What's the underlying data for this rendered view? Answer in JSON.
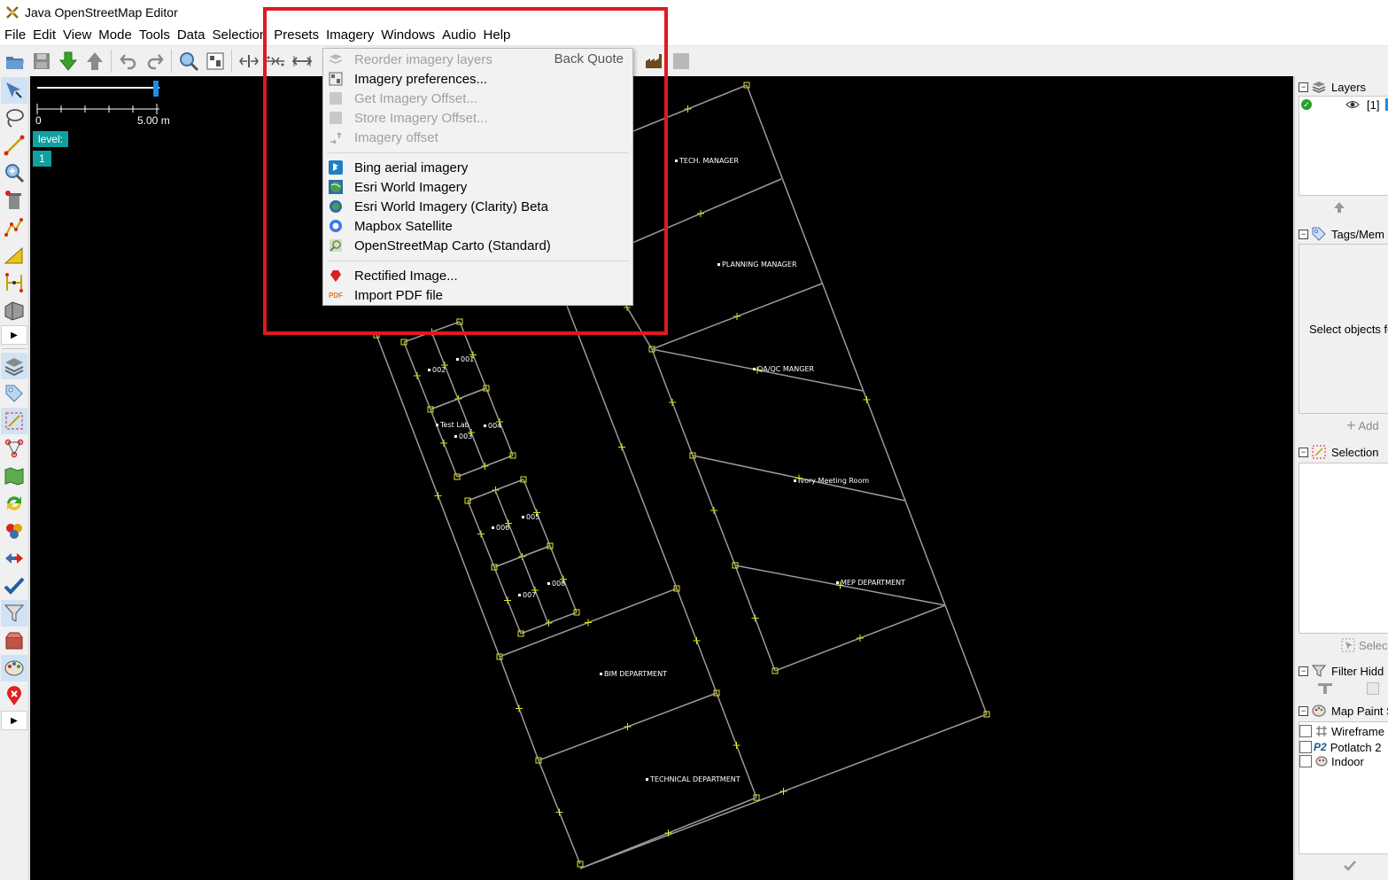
{
  "window": {
    "title": "Java OpenStreetMap Editor"
  },
  "menubar": [
    "File",
    "Edit",
    "View",
    "Mode",
    "Tools",
    "Data",
    "Selection",
    "Presets",
    "Imagery",
    "Windows",
    "Audio",
    "Help"
  ],
  "imagery_menu": {
    "items": [
      {
        "label": "Reorder imagery layers",
        "accel": "Back Quote",
        "enabled": false,
        "icon": "reorder-layers-icon"
      },
      {
        "label": "Imagery preferences...",
        "enabled": true,
        "icon": "imagery-preferences-icon"
      },
      {
        "label": "Get Imagery Offset...",
        "enabled": false,
        "icon": "get-offset-icon"
      },
      {
        "label": "Store Imagery Offset...",
        "enabled": false,
        "icon": "store-offset-icon"
      },
      {
        "label": "Imagery offset",
        "enabled": false,
        "icon": "imagery-offset-icon"
      },
      {
        "label": "Bing aerial imagery",
        "enabled": true,
        "icon": "bing-icon"
      },
      {
        "label": "Esri World Imagery",
        "enabled": true,
        "icon": "esri-icon"
      },
      {
        "label": "Esri World Imagery (Clarity) Beta",
        "enabled": true,
        "icon": "esri-clarity-icon"
      },
      {
        "label": "Mapbox Satellite",
        "enabled": true,
        "icon": "mapbox-icon"
      },
      {
        "label": "OpenStreetMap Carto (Standard)",
        "enabled": true,
        "icon": "osm-carto-icon"
      },
      {
        "label": "Rectified Image...",
        "enabled": true,
        "icon": "rectified-image-icon"
      },
      {
        "label": "Import PDF file",
        "enabled": true,
        "icon": "pdf-icon"
      }
    ],
    "pdf_icon_text": "PDF"
  },
  "map": {
    "scale_label_start": "0",
    "scale_label_end": "5.00 m",
    "level_label": "level:",
    "level_value": "1",
    "room_labels": [
      "TECH. MANAGER",
      "PLANNING MANAGER",
      "QA/QC MANGER",
      "Ivory Meeting Room",
      "MEP DEPARTMENT",
      "BIM DEPARTMENT",
      "TECHNICAL DEPARTMENT",
      "001",
      "002",
      "Test Lab",
      "003",
      "004",
      "005",
      "006",
      "007",
      "008"
    ]
  },
  "right_panel": {
    "layers_title": "Layers",
    "layer_entry": "[1]",
    "tags_title": "Tags/Mem",
    "tags_empty": "Select objects fo",
    "tags_add": "Add",
    "selection_title": "Selection",
    "selection_foot": "Selec",
    "filter_title": "Filter Hidd",
    "mappaint_title": "Map Paint S",
    "mappaint_styles": [
      "Wireframe",
      "Potlatch 2",
      "Indoor"
    ],
    "potlatch_badge": "P2"
  },
  "colors": {
    "map_background": "#000000",
    "way_stroke": "#9a9a9a",
    "node_color": "#e6e619",
    "level_tag": "#10a0a0",
    "highlight": "#e0191e"
  }
}
